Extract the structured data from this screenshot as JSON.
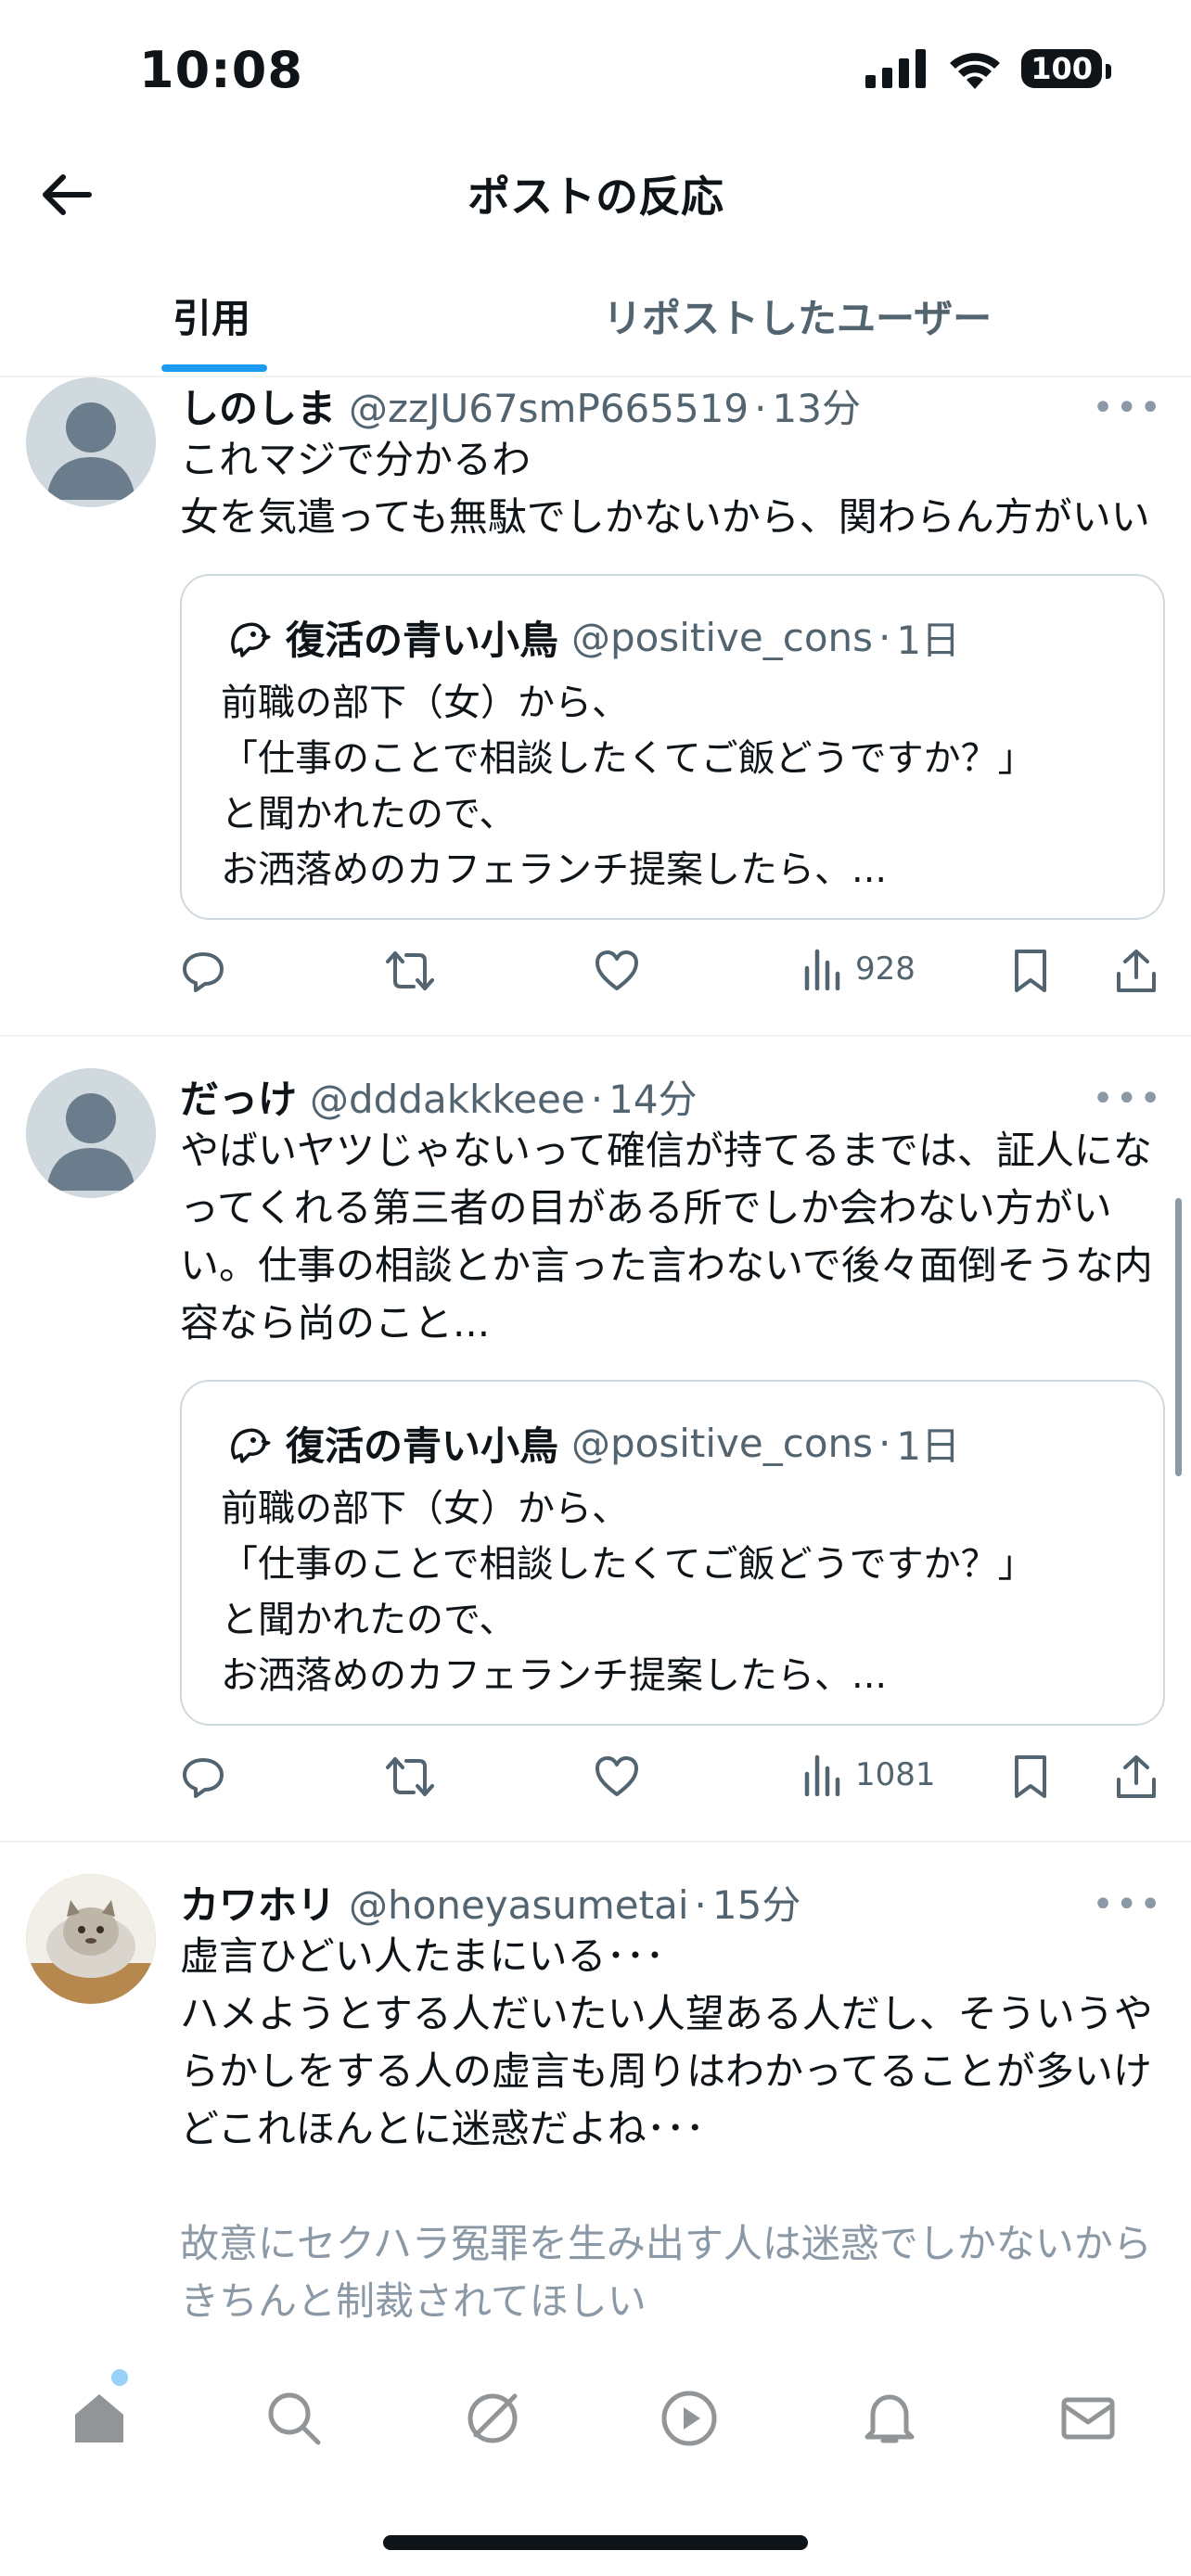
{
  "status_bar": {
    "time": "10:08",
    "battery": "100"
  },
  "header": {
    "title": "ポストの反応"
  },
  "tabs": [
    {
      "label": "引用"
    },
    {
      "label": "リポストしたユーザー"
    }
  ],
  "posts": [
    {
      "name": "しのしま",
      "handle": "@zzJU67smP665519",
      "time": "13分",
      "text": "これマジで分かるわ\n女を気遣っても無駄でしかないから、関わらん方がいい",
      "quote": {
        "name": "復活の青い小鳥",
        "handle": "@positive_cons",
        "time": "1日",
        "text": "前職の部下（女）から、\n「仕事のことで相談したくてご飯どうですか？」\nと聞かれたので、\nお洒落めのカフェランチ提案したら、..."
      },
      "views": "928"
    },
    {
      "name": "だっけ",
      "handle": "@dddakkkeee",
      "time": "14分",
      "text": "やばいヤツじゃないって確信が持てるまでは、証人になってくれる第三者の目がある所でしか会わない方がいい。仕事の相談とか言った言わないで後々面倒そうな内容なら尚のこと...",
      "quote": {
        "name": "復活の青い小鳥",
        "handle": "@positive_cons",
        "time": "1日",
        "text": "前職の部下（女）から、\n「仕事のことで相談したくてご飯どうですか？」\nと聞かれたので、\nお洒落めのカフェランチ提案したら、..."
      },
      "views": "1081"
    },
    {
      "name": "カワホリ",
      "handle": "@honeyasumetai",
      "time": "15分",
      "text": "虚言ひどい人たまにいる･･･\nハメようとする人だいたい人望ある人だし、そういうやらかしをする人の虚言も周りはわかってることが多いけどこれほんとに迷惑だよね･･･",
      "text_faded": "故意にセクハラ冤罪を生み出す人は迷惑でしかないからきちんと制裁されてほしい"
    }
  ],
  "icons": {
    "back": "arrow-left-icon",
    "reply": "reply-icon",
    "repost": "repost-icon",
    "like": "heart-icon",
    "views": "views-icon",
    "bookmark": "bookmark-icon",
    "share": "share-icon",
    "nav": [
      "home-icon",
      "search-icon",
      "grok-icon",
      "video-icon",
      "notifications-icon",
      "messages-icon"
    ]
  },
  "colors": {
    "accent": "#1d9bf0",
    "text": "#0f1419",
    "secondary": "#536471",
    "border": "#cfd9de"
  }
}
